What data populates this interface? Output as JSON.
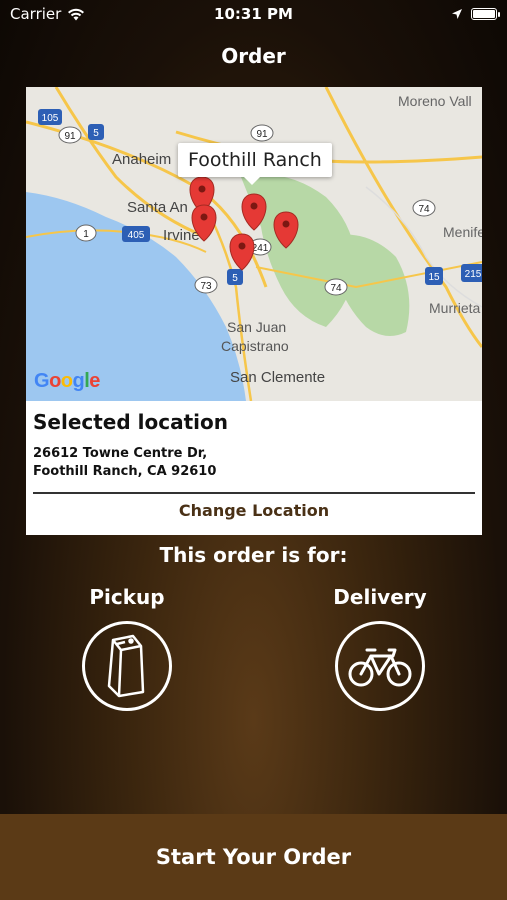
{
  "status_bar": {
    "carrier": "Carrier",
    "time": "10:31 PM"
  },
  "header": {
    "title": "Order"
  },
  "map": {
    "tooltip": "Foothill Ranch",
    "google_logo": "Google",
    "place_labels": [
      "Moreno Vall",
      "Anaheim",
      "Santa An",
      "Irvine",
      "Menife",
      "Murrieta",
      "San Juan",
      "Capistrano",
      "San Clemente"
    ],
    "highway_shields": [
      "105",
      "5",
      "91",
      "91",
      "405",
      "1",
      "74",
      "73",
      "241",
      "5",
      "74",
      "15",
      "215"
    ]
  },
  "location": {
    "section_title": "Selected location",
    "address_line1": "26612 Towne Centre Dr,",
    "address_line2": "Foothill Ranch, CA 92610",
    "change_label": "Change Location"
  },
  "order_type": {
    "heading": "This order is for:",
    "pickup_label": "Pickup",
    "delivery_label": "Delivery"
  },
  "footer": {
    "start_label": "Start Your Order"
  },
  "colors": {
    "accent_brown": "#5b3a16",
    "link_brown": "#4a3116",
    "pin_red": "#e53935"
  }
}
